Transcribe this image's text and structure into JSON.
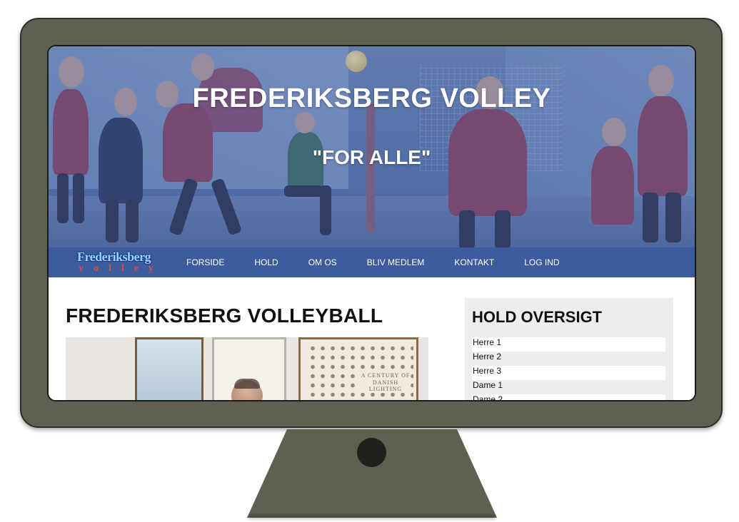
{
  "hero": {
    "title": "FREDERIKSBERG VOLLEY",
    "subtitle": "\"FOR ALLE\""
  },
  "nav": {
    "logo_top": "Frederiksberg",
    "logo_bottom": "volley",
    "items": [
      "FORSIDE",
      "HOLD",
      "OM OS",
      "BLIV MEDLEM",
      "KONTAKT",
      "LOG IND"
    ]
  },
  "main": {
    "title": "FREDERIKSBERG VOLLEYBALL",
    "photo_poster_text": "A CENTURY OF DANISH LIGHTING"
  },
  "sidebar": {
    "title": "HOLD OVERSIGT",
    "teams": [
      "Herre 1",
      "Herre 2",
      "Herre 3",
      "Dame 1",
      "Dame 2"
    ]
  },
  "colors": {
    "nav_bg": "#3d5c9e",
    "monitor_body": "#5f6150",
    "sidebar_bg": "#ededed"
  }
}
